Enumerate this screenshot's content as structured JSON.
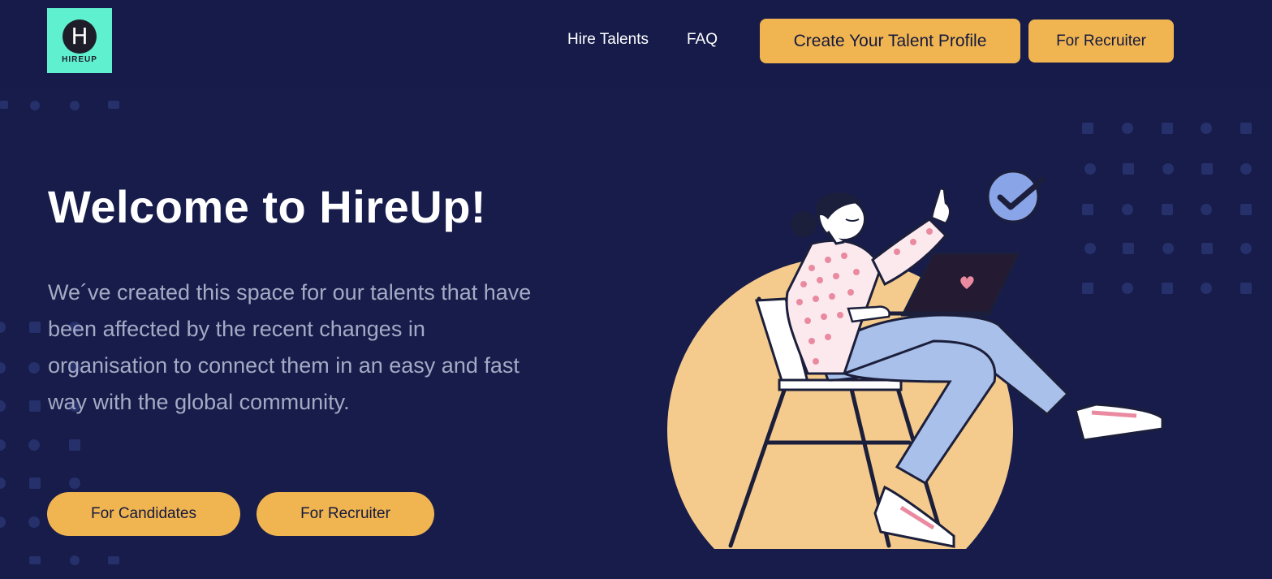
{
  "header": {
    "logo_letter": "H",
    "logo_text": "HIREUP",
    "nav": [
      {
        "label": "Hire Talents"
      },
      {
        "label": "FAQ"
      }
    ],
    "create_profile_label": "Create Your Talent Profile",
    "for_recruiter_label": "For Recruiter"
  },
  "hero": {
    "title": "Welcome to HireUp!",
    "description": "We´ve created this space for our talents that have been affected by the recent changes in organisation to connect them in an easy and fast way with the global community.",
    "buttons": {
      "candidates": "For Candidates",
      "recruiter": "For Recruiter"
    }
  },
  "colors": {
    "background": "#171c4b",
    "accent": "#f0b550",
    "logo_bg": "#5ff0cf",
    "check_circle": "#8aa4e8"
  },
  "icons": {
    "logo": "hireup-logo-icon",
    "check": "check-circle-icon",
    "illustration": "woman-with-laptop-illustration"
  }
}
